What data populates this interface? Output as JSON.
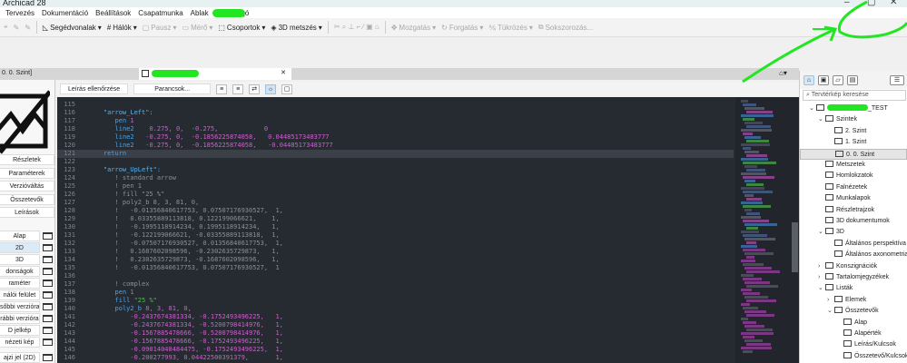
{
  "app": {
    "title": "Archicad 28",
    "window_controls": [
      "–",
      "▢",
      "✕"
    ]
  },
  "menu": [
    "Tervezés",
    "Dokumentáció",
    "Beállítások",
    "Csapatmunka",
    "Ablak",
    "Súgó"
  ],
  "toolbar": [
    {
      "label": "Segédvonalak",
      "icon": "ruler-triangle-icon",
      "enabled": true
    },
    {
      "label": "Hálók",
      "icon": "grid-icon",
      "enabled": true
    },
    {
      "label": "Pausz",
      "icon": "trace-icon",
      "enabled": false
    },
    {
      "label": "Mérő",
      "icon": "measure-icon",
      "enabled": false
    },
    {
      "label": "Csoportok",
      "icon": "group-icon",
      "enabled": true
    },
    {
      "label": "3D metszés",
      "icon": "3d-cut-icon",
      "enabled": true
    },
    {
      "label": "Mozgatás",
      "icon": "move-icon",
      "enabled": false
    },
    {
      "label": "Forgatás",
      "icon": "rotate-icon",
      "enabled": false
    },
    {
      "label": "Tükrözés",
      "icon": "mirror-icon",
      "enabled": false
    },
    {
      "label": "Sokszorozás...",
      "icon": "multiply-icon",
      "enabled": false
    }
  ],
  "tabs": {
    "left": "0. 0. Szint]",
    "active_close": "✕"
  },
  "left_panel": {
    "buttons": [
      "Részletek",
      "Paraméterek",
      "Verzióváltás",
      "Összetevők",
      "Leírások"
    ],
    "scripts": [
      {
        "label": "Alap",
        "selected": false
      },
      {
        "label": "2D",
        "selected": true
      },
      {
        "label": "3D",
        "selected": false
      },
      {
        "label": "donságok",
        "selected": false
      },
      {
        "label": "raméter",
        "selected": false
      },
      {
        "label": "nálói felület",
        "selected": false
      },
      {
        "label": "sőbbi verzióra",
        "selected": false
      },
      {
        "label": "rábbi verzióra",
        "selected": false
      },
      {
        "label": "D jelkép",
        "selected": false
      },
      {
        "label": "nézeti kép",
        "selected": false
      },
      {
        "label": "ajzi jel (2D)",
        "selected": false
      }
    ]
  },
  "editor_toolbar": {
    "check": "Leírás ellenőrzése",
    "commands": "Parancsok..."
  },
  "code": [
    {
      "n": "115",
      "parts": []
    },
    {
      "n": "116",
      "parts": [
        [
          "p",
          "    "
        ],
        [
          "lab",
          "\"arrow_Left\":"
        ]
      ]
    },
    {
      "n": "117",
      "parts": [
        [
          "p",
          "       "
        ],
        [
          "k",
          "pen"
        ],
        [
          "n",
          " 1"
        ]
      ]
    },
    {
      "n": "118",
      "parts": [
        [
          "p",
          "       "
        ],
        [
          "k",
          "line2"
        ],
        [
          "n",
          "    0.275, 0,  -0.275,            0"
        ]
      ]
    },
    {
      "n": "119",
      "parts": [
        [
          "p",
          "       "
        ],
        [
          "k",
          "line2"
        ],
        [
          "n",
          "   -0.275, 0,  -0.1856225874058,   0.04485173483777"
        ]
      ]
    },
    {
      "n": "120",
      "parts": [
        [
          "p",
          "       "
        ],
        [
          "k",
          "line2"
        ],
        [
          "n",
          "   -0.275, 0,  -0.1856225874058,   -0.04485173483777"
        ]
      ]
    },
    {
      "n": "121",
      "hl": true,
      "parts": [
        [
          "p",
          "    "
        ],
        [
          "k",
          "return"
        ]
      ]
    },
    {
      "n": "122",
      "parts": []
    },
    {
      "n": "123",
      "parts": [
        [
          "p",
          "    "
        ],
        [
          "lab",
          "\"arrow_UpLeft\":"
        ]
      ]
    },
    {
      "n": "124",
      "parts": [
        [
          "c",
          "       ! standard arrow"
        ]
      ]
    },
    {
      "n": "125",
      "parts": [
        [
          "c",
          "       ! pen 1"
        ]
      ]
    },
    {
      "n": "126",
      "parts": [
        [
          "c",
          "       ! fill \"25 %\""
        ]
      ]
    },
    {
      "n": "127",
      "parts": [
        [
          "c",
          "       ! poly2_b 8, 3, 81, 0,"
        ]
      ]
    },
    {
      "n": "128",
      "parts": [
        [
          "c",
          "       !   -0.01356840617753, 0.07507176930527,  1,"
        ]
      ]
    },
    {
      "n": "129",
      "parts": [
        [
          "c",
          "       !   0.03355889113818, 0.122199066621,    1,"
        ]
      ]
    },
    {
      "n": "130",
      "parts": [
        [
          "c",
          "       !   -0.1995118914234, 0.1995118914234,   1,"
        ]
      ]
    },
    {
      "n": "131",
      "parts": [
        [
          "c",
          "       !   -0.122199066621, -0.03355889113818,  1,"
        ]
      ]
    },
    {
      "n": "132",
      "parts": [
        [
          "c",
          "       !   -0.07507176930527, 0.01356840617753,  1,"
        ]
      ]
    },
    {
      "n": "133",
      "parts": [
        [
          "c",
          "       !   0.1687602098596, -0.2302635729873,   1,"
        ]
      ]
    },
    {
      "n": "134",
      "parts": [
        [
          "c",
          "       !   0.2302635729873, -0.1687602098596,   1,"
        ]
      ]
    },
    {
      "n": "135",
      "parts": [
        [
          "c",
          "       !   -0.01356840617753, 0.07507176930527,  1"
        ]
      ]
    },
    {
      "n": "136",
      "parts": []
    },
    {
      "n": "137",
      "parts": [
        [
          "c",
          "       ! complex"
        ]
      ]
    },
    {
      "n": "138",
      "parts": [
        [
          "p",
          "       "
        ],
        [
          "k",
          "pen"
        ],
        [
          "n",
          " 1"
        ]
      ]
    },
    {
      "n": "139",
      "parts": [
        [
          "p",
          "       "
        ],
        [
          "k",
          "fill"
        ],
        [
          "s",
          " \"25 %\""
        ]
      ]
    },
    {
      "n": "140",
      "parts": [
        [
          "p",
          "       "
        ],
        [
          "k",
          "poly2_b"
        ],
        [
          "n",
          " 8, 3, 81, 0,"
        ]
      ]
    },
    {
      "n": "141",
      "parts": [
        [
          "n",
          "           -0.2437674381334, -0.1752493496225,   1,"
        ]
      ]
    },
    {
      "n": "142",
      "parts": [
        [
          "n",
          "           -0.2437674381334, -0.5200798414976,   1,"
        ]
      ]
    },
    {
      "n": "143",
      "parts": [
        [
          "n",
          "           -0.1567885478666, -0.5200798414976,   1,"
        ]
      ]
    },
    {
      "n": "144",
      "parts": [
        [
          "n",
          "           -0.1567885478666, -0.1752493496225,   1,"
        ]
      ]
    },
    {
      "n": "145",
      "parts": [
        [
          "n",
          "           -0.09014048484475, -0.1752493496225,  1,"
        ]
      ]
    },
    {
      "n": "146",
      "parts": [
        [
          "n",
          "           -0.200277993, 0.04422500391379,       1,"
        ]
      ]
    }
  ],
  "navigator": {
    "search_placeholder": "Tervtérkép keresése",
    "items": [
      {
        "label": "_TEST",
        "level": 0,
        "arrow": "⌄"
      },
      {
        "label": "Szintek",
        "level": 1,
        "arrow": "⌄"
      },
      {
        "label": "2. Szint",
        "level": 2,
        "arrow": ""
      },
      {
        "label": "1. Szint",
        "level": 2,
        "arrow": ""
      },
      {
        "label": "0. 0. Szint",
        "level": 2,
        "arrow": "",
        "selected": true
      },
      {
        "label": "Metszetek",
        "level": 1,
        "arrow": ""
      },
      {
        "label": "Homlokzatok",
        "level": 1,
        "arrow": ""
      },
      {
        "label": "Falnézetek",
        "level": 1,
        "arrow": ""
      },
      {
        "label": "Munkalapok",
        "level": 1,
        "arrow": ""
      },
      {
        "label": "Részletrajzok",
        "level": 1,
        "arrow": ""
      },
      {
        "label": "3D dokumentumok",
        "level": 1,
        "arrow": ""
      },
      {
        "label": "3D",
        "level": 1,
        "arrow": "⌄"
      },
      {
        "label": "Általános perspektíva",
        "level": 2,
        "arrow": ""
      },
      {
        "label": "Általános axonometria",
        "level": 2,
        "arrow": ""
      },
      {
        "label": "Konszignációk",
        "level": 1,
        "arrow": "›"
      },
      {
        "label": "Tartalomjegyzékek",
        "level": 1,
        "arrow": "›"
      },
      {
        "label": "Listák",
        "level": 1,
        "arrow": "⌄"
      },
      {
        "label": "Elemek",
        "level": 2,
        "arrow": "›"
      },
      {
        "label": "Összetevők",
        "level": 2,
        "arrow": "⌄"
      },
      {
        "label": "Alap",
        "level": 3,
        "arrow": ""
      },
      {
        "label": "Alapérték",
        "level": 3,
        "arrow": ""
      },
      {
        "label": "Leírás/Kulcsok",
        "level": 3,
        "arrow": ""
      },
      {
        "label": "Összetevő/Kulcsok",
        "level": 3,
        "arrow": ""
      }
    ]
  },
  "colors": {
    "editor_bg": "#262a31",
    "keyword": "#4aa3e8",
    "number": "#d05fd0",
    "comment": "#8b9099",
    "annotation": "#22e622"
  }
}
